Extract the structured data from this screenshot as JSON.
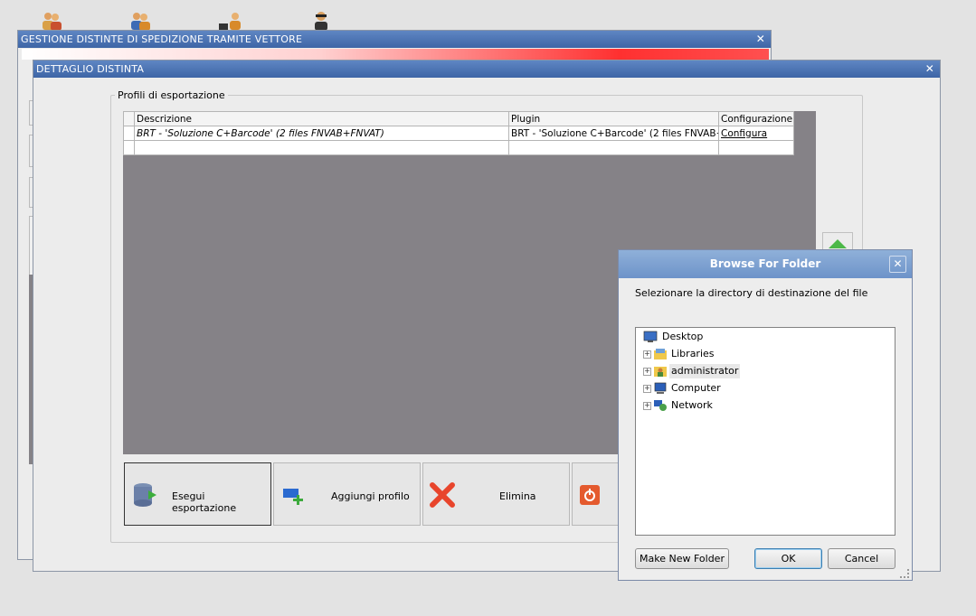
{
  "desktop": {
    "icons": [
      "users-icon",
      "users-icon",
      "users-icon",
      "agent-icon"
    ]
  },
  "back_window": {
    "title": "GESTIONE DISTINTE DI SPEDIZIONE TRAMITE VETTORE"
  },
  "detail_window": {
    "title": "DETTAGLIO DISTINTA",
    "group_label": "Profili di esportazione",
    "table": {
      "headers": [
        "Descrizione",
        "Plugin",
        "Configurazione"
      ],
      "rows": [
        {
          "descrizione": "BRT - 'Soluzione C+Barcode' (2 files FNVAB+FNVAT)",
          "plugin": "BRT - 'Soluzione C+Barcode' (2 files FNVAB+…",
          "config": "Configura"
        }
      ]
    },
    "buttons": {
      "export": "Esegui esportazione",
      "add_profile": "Aggiungi profilo",
      "delete": "Elimina"
    }
  },
  "browse_dialog": {
    "title": "Browse For Folder",
    "instruction": "Selezionare la directory di destinazione del file",
    "tree": [
      {
        "label": "Desktop",
        "icon": "desktop-icon",
        "expandable": false
      },
      {
        "label": "Libraries",
        "icon": "libraries-icon",
        "expandable": true
      },
      {
        "label": "administrator",
        "icon": "user-folder-icon",
        "expandable": true,
        "selected": true
      },
      {
        "label": "Computer",
        "icon": "computer-icon",
        "expandable": true
      },
      {
        "label": "Network",
        "icon": "network-icon",
        "expandable": true
      }
    ],
    "make_new_folder": "Make New Folder",
    "ok": "OK",
    "cancel": "Cancel"
  },
  "colors": {
    "titlebar": "#4a72b0",
    "grid_bg": "#858287",
    "dialog_title": "#7fa2d2"
  }
}
